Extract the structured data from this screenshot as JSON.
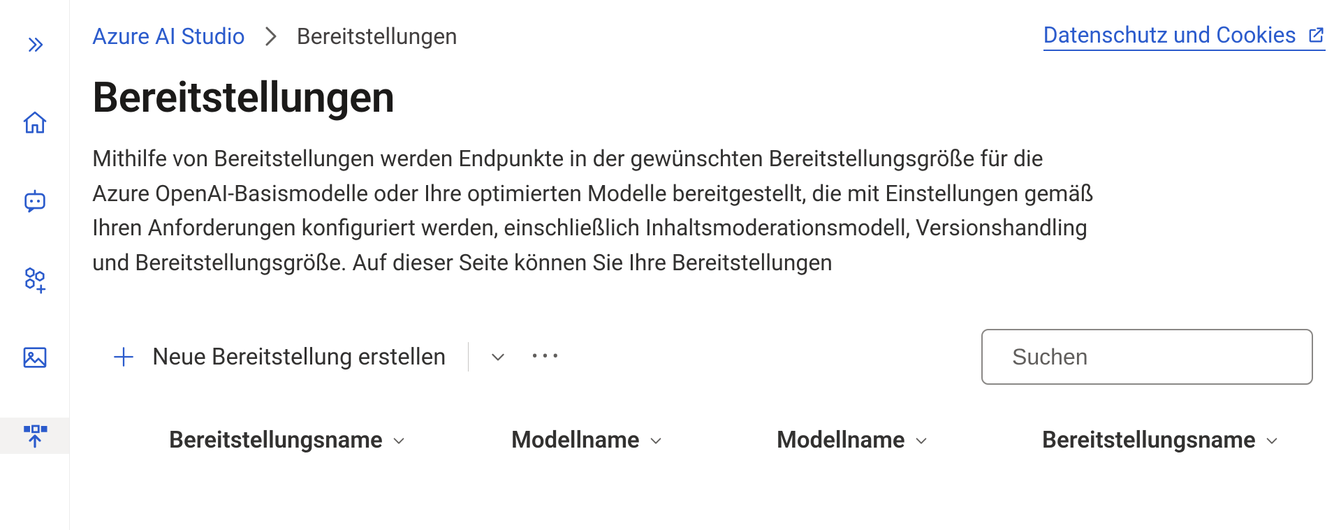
{
  "colors": {
    "accent": "#2b5bcc"
  },
  "breadcrumb": {
    "root": "Azure AI Studio",
    "current": "Bereitstellungen"
  },
  "privacy": {
    "label": "Datenschutz und Cookies"
  },
  "page": {
    "title": "Bereitstellungen",
    "description": "Mithilfe von Bereitstellungen werden Endpunkte in der gewünschten Bereitstellungsgröße für die Azure OpenAI-Basismodelle oder Ihre optimierten Modelle bereitgestellt, die mit Einstellungen gemäß Ihren Anforderungen konfiguriert werden, einschließlich Inhaltsmoderationsmodell, Versionshandling und Bereitstellungsgröße. Auf dieser Seite können Sie Ihre Bereitstellungen"
  },
  "toolbar": {
    "new_label": "Neue Bereitstellung erstellen",
    "search_placeholder": "Suchen"
  },
  "table": {
    "columns": [
      "Bereitstellungsname",
      "Modellname",
      "Modellname",
      "Bereitstellungsname"
    ]
  },
  "sidebar": {
    "items": [
      {
        "name": "expand"
      },
      {
        "name": "home"
      },
      {
        "name": "chat"
      },
      {
        "name": "models"
      },
      {
        "name": "images"
      },
      {
        "name": "deployments",
        "active": true
      }
    ]
  }
}
